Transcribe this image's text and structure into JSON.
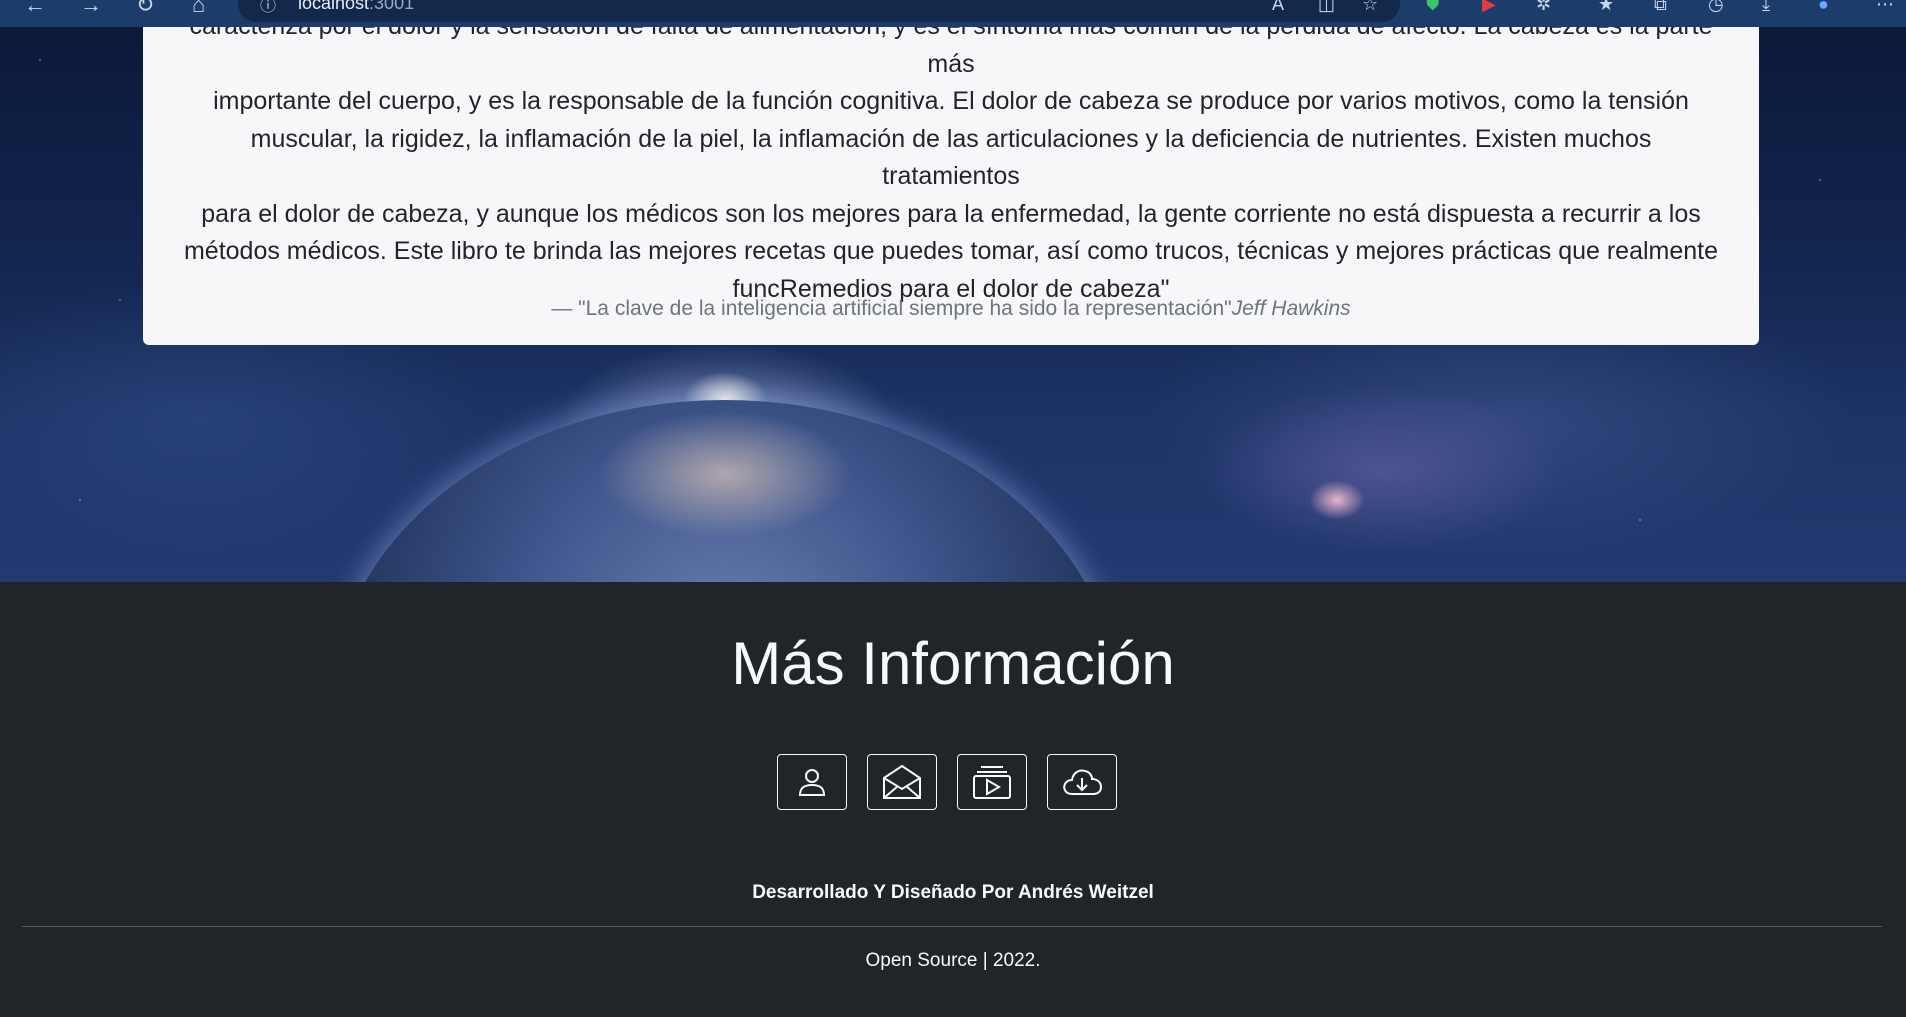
{
  "browser": {
    "url_host": "localhost",
    "url_port": ":3001"
  },
  "quote_card": {
    "lines": [
      "caracteriza por el dolor y la sensación de falta de alimentación, y es el síntoma más común de la pérdida de afecto. La cabeza es la parte más",
      "importante del cuerpo, y es la responsable de la función cognitiva. El dolor de cabeza se produce por varios motivos, como la tensión",
      "muscular, la rigidez, la inflamación de la piel, la inflamación de las articulaciones y la deficiencia de nutrientes. Existen muchos tratamientos",
      "para el dolor de cabeza, y aunque los médicos son los mejores para la enfermedad, la gente corriente no está dispuesta a recurrir a los",
      "métodos médicos. Este libro te brinda las mejores recetas que puedes tomar, así como trucos, técnicas y mejores prácticas que realmente",
      "funcRemedios para el dolor de cabeza\""
    ],
    "citation_quote": "— \"La clave de la inteligencia artificial siempre ha sido la representación\"",
    "citation_author": "Jeff Hawkins"
  },
  "footer": {
    "title": "Más Información",
    "icon_buttons": [
      {
        "icon": "person-icon"
      },
      {
        "icon": "envelope-open-icon"
      },
      {
        "icon": "collection-play-icon"
      },
      {
        "icon": "cloud-download-icon"
      }
    ],
    "credit": "Desarrollado Y Diseñado Por Andrés Weitzel",
    "copyright": "Open Source | 2022."
  },
  "colors": {
    "footer_bg": "#212529",
    "card_bg": "#f7f7f9",
    "browser_bar": "#1c3d6b"
  }
}
